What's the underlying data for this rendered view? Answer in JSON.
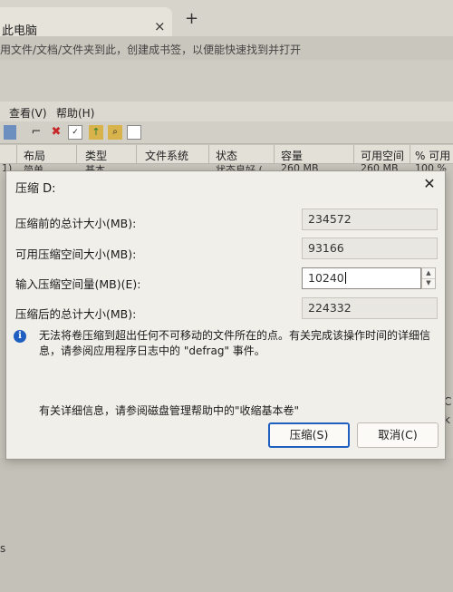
{
  "browser": {
    "tab_title": "此电脑",
    "tab_close": "×",
    "new_tab": "+",
    "bookmark_hint": "用文件/文档/文件夹到此，创建成书签，以便能快速找到并打开"
  },
  "disk_manager": {
    "menu": [
      "查看(V)",
      "帮助(H)"
    ],
    "columns": [
      "布局",
      "类型",
      "文件系统",
      "状态",
      "容量",
      "可用空间",
      "% 可用"
    ],
    "partial_row": [
      "1)",
      "简单",
      "基本",
      "",
      "状态良好 (",
      "260 MB",
      "260 MB",
      "100 %"
    ],
    "right_edge": [
      "C",
      "k"
    ],
    "bottom_edge": "s"
  },
  "dialog": {
    "title": "压缩 D:",
    "close": "✕",
    "rows": [
      {
        "label": "压缩前的总计大小(MB):",
        "value": "234572"
      },
      {
        "label": "可用压缩空间大小(MB):",
        "value": "93166"
      },
      {
        "label": "输入压缩空间量(MB)(E):",
        "value": "10240"
      },
      {
        "label": "压缩后的总计大小(MB):",
        "value": "224332"
      }
    ],
    "info_icon": "i",
    "warning": "无法将卷压缩到超出任何不可移动的文件所在的点。有关完成该操作时间的详细信息，请参阅应用程序日志中的 \"defrag\" 事件。",
    "help": "有关详细信息，请参阅磁盘管理帮助中的\"收缩基本卷\"",
    "shrink_button": "压缩(S)",
    "cancel_button": "取消(C)",
    "spinner_up": "▲",
    "spinner_down": "▼"
  },
  "colors": {
    "accent": "#1f5fbf",
    "delete_icon": "#c62828"
  }
}
